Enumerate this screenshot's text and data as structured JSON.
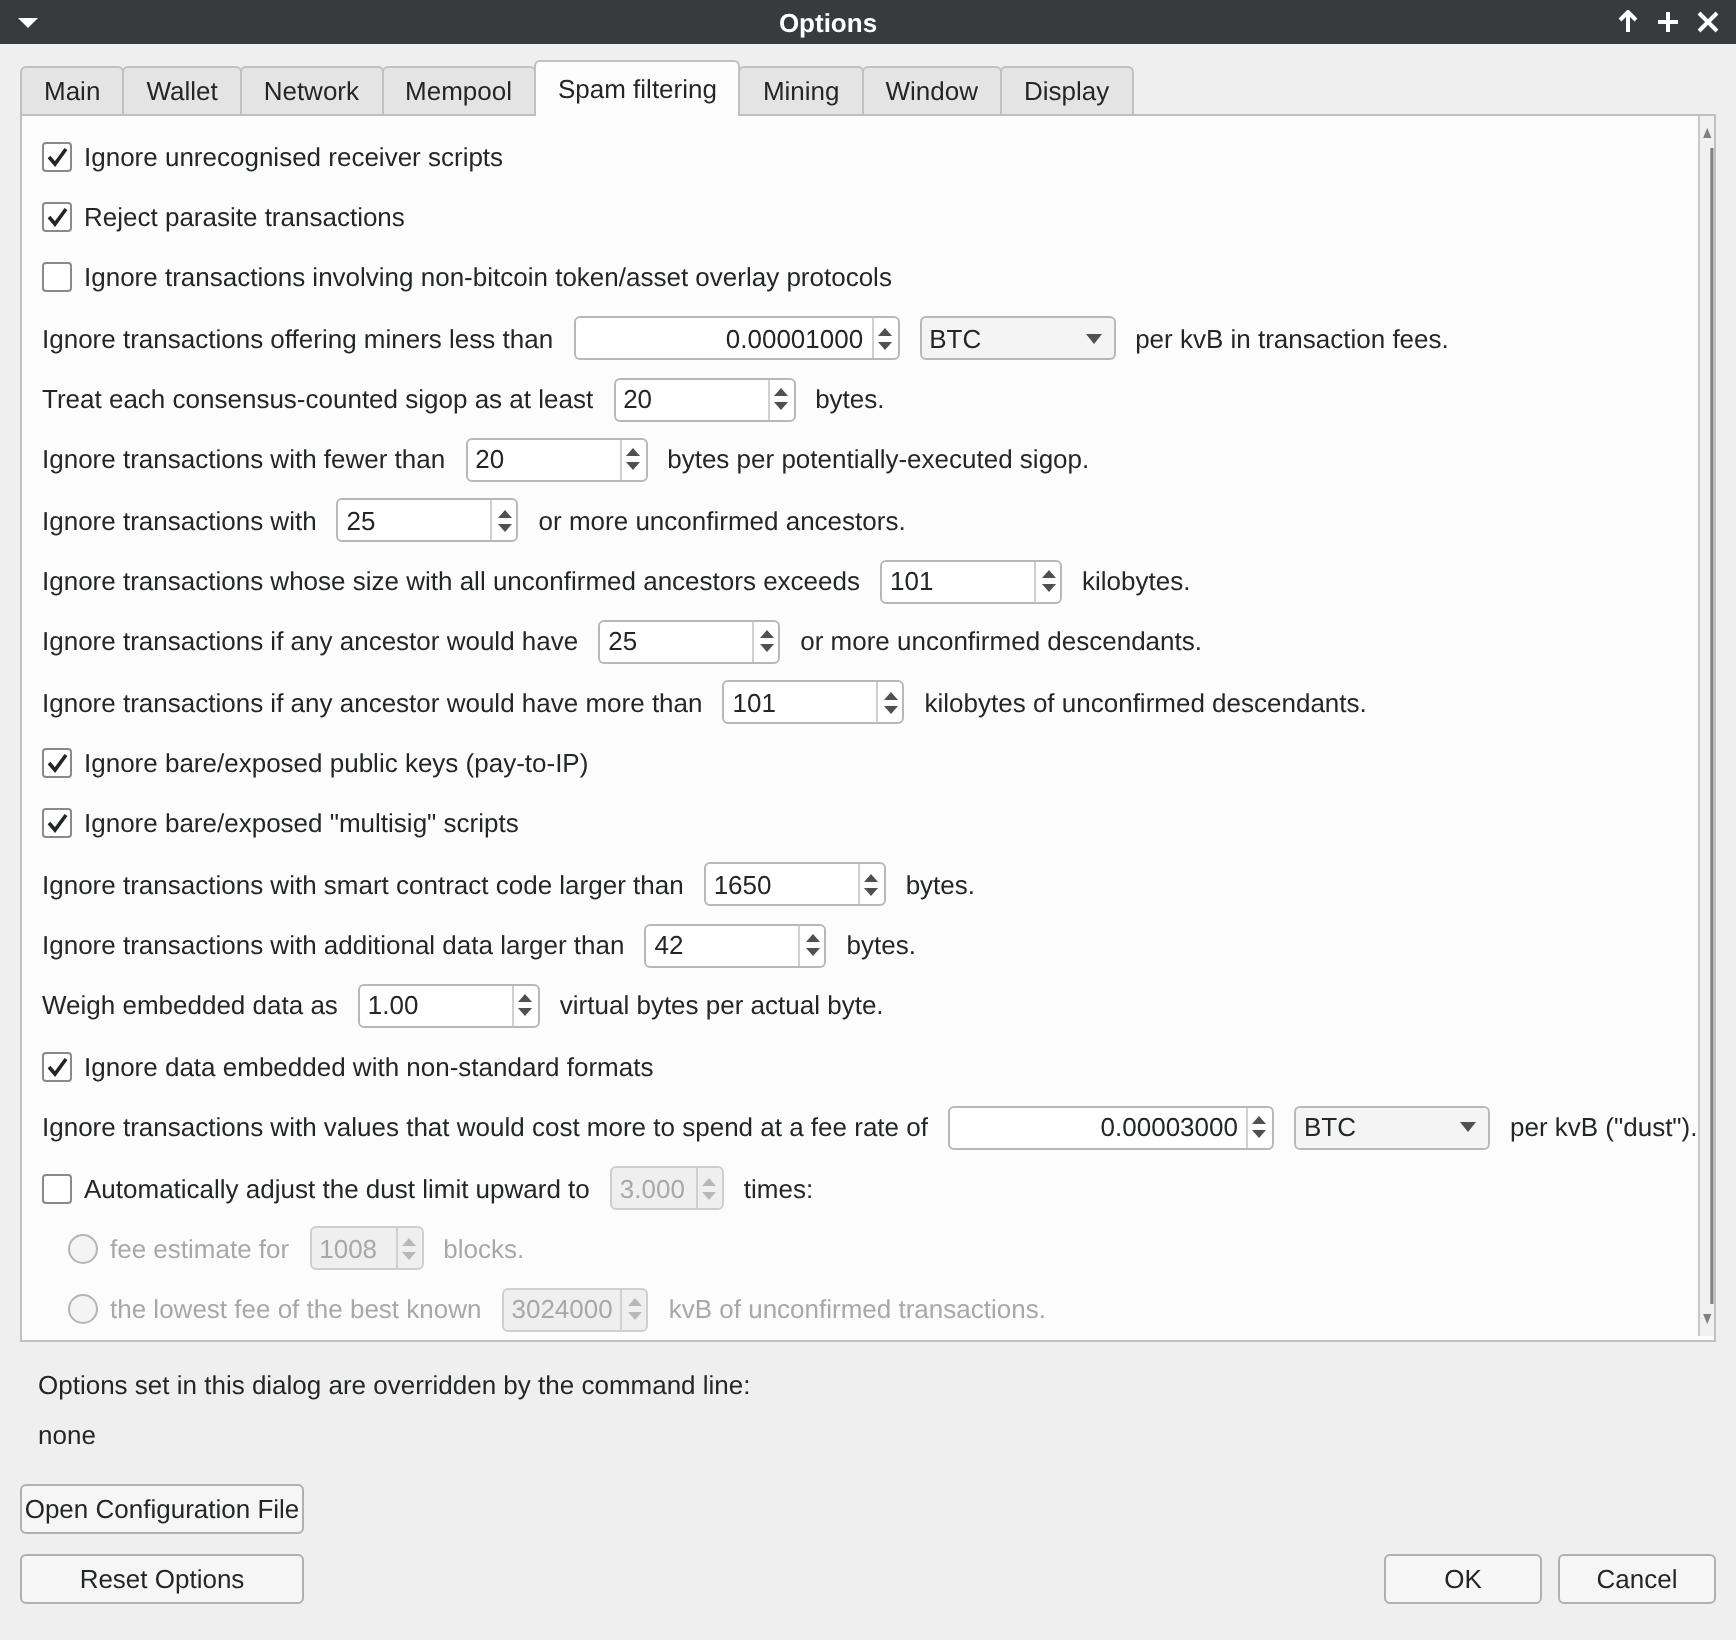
{
  "window": {
    "title": "Options"
  },
  "tabs": [
    {
      "label": "Main",
      "selected": false
    },
    {
      "label": "Wallet",
      "selected": false
    },
    {
      "label": "Network",
      "selected": false
    },
    {
      "label": "Mempool",
      "selected": false
    },
    {
      "label": "Spam filtering",
      "selected": true
    },
    {
      "label": "Mining",
      "selected": false
    },
    {
      "label": "Window",
      "selected": false
    },
    {
      "label": "Display",
      "selected": false
    }
  ],
  "rows": [
    {
      "kind": "checkbox",
      "checked": true,
      "parts": [
        {
          "kind": "text",
          "text": "Ignore unrecognised receiver scripts"
        }
      ]
    },
    {
      "kind": "checkbox",
      "checked": true,
      "parts": [
        {
          "kind": "text",
          "text": "Reject parasite transactions"
        }
      ]
    },
    {
      "kind": "checkbox",
      "checked": false,
      "parts": [
        {
          "kind": "text",
          "text": "Ignore transactions involving non-bitcoin token/asset overlay protocols"
        }
      ]
    },
    {
      "kind": "plain",
      "parts": [
        {
          "kind": "text",
          "text": "Ignore transactions offering miners less than"
        },
        {
          "kind": "amount",
          "value": "0.00001000"
        },
        {
          "kind": "combo",
          "value": "BTC"
        },
        {
          "kind": "text",
          "text": "per kvB in transaction fees."
        }
      ]
    },
    {
      "kind": "plain",
      "parts": [
        {
          "kind": "text",
          "text": "Treat each consensus-counted sigop as at least"
        },
        {
          "kind": "spin",
          "value": "20"
        },
        {
          "kind": "text",
          "text": "bytes."
        }
      ]
    },
    {
      "kind": "plain",
      "parts": [
        {
          "kind": "text",
          "text": "Ignore transactions with fewer than"
        },
        {
          "kind": "spin",
          "value": "20"
        },
        {
          "kind": "text",
          "text": "bytes per potentially-executed sigop."
        }
      ]
    },
    {
      "kind": "plain",
      "parts": [
        {
          "kind": "text",
          "text": "Ignore transactions with"
        },
        {
          "kind": "spin",
          "value": "25"
        },
        {
          "kind": "text",
          "text": "or more unconfirmed ancestors."
        }
      ]
    },
    {
      "kind": "plain",
      "parts": [
        {
          "kind": "text",
          "text": "Ignore transactions whose size with all unconfirmed ancestors exceeds"
        },
        {
          "kind": "spin",
          "value": "101"
        },
        {
          "kind": "text",
          "text": "kilobytes."
        }
      ]
    },
    {
      "kind": "plain",
      "parts": [
        {
          "kind": "text",
          "text": "Ignore transactions if any ancestor would have"
        },
        {
          "kind": "spin",
          "value": "25"
        },
        {
          "kind": "text",
          "text": "or more unconfirmed descendants."
        }
      ]
    },
    {
      "kind": "plain",
      "parts": [
        {
          "kind": "text",
          "text": "Ignore transactions if any ancestor would have more than"
        },
        {
          "kind": "spin",
          "value": "101"
        },
        {
          "kind": "text",
          "text": "kilobytes of unconfirmed descendants."
        }
      ]
    },
    {
      "kind": "checkbox",
      "checked": true,
      "parts": [
        {
          "kind": "text",
          "text": "Ignore bare/exposed public keys (pay-to-IP)"
        }
      ]
    },
    {
      "kind": "checkbox",
      "checked": true,
      "parts": [
        {
          "kind": "text",
          "text": "Ignore bare/exposed \"multisig\" scripts"
        }
      ]
    },
    {
      "kind": "plain",
      "parts": [
        {
          "kind": "text",
          "text": "Ignore transactions with smart contract code larger than"
        },
        {
          "kind": "spin",
          "value": "1650"
        },
        {
          "kind": "text",
          "text": "bytes."
        }
      ]
    },
    {
      "kind": "plain",
      "parts": [
        {
          "kind": "text",
          "text": "Ignore transactions with additional data larger than"
        },
        {
          "kind": "spin",
          "value": "42"
        },
        {
          "kind": "text",
          "text": "bytes."
        }
      ]
    },
    {
      "kind": "plain",
      "parts": [
        {
          "kind": "text",
          "text": "Weigh embedded data as"
        },
        {
          "kind": "spin",
          "value": "1.00"
        },
        {
          "kind": "text",
          "text": "virtual bytes per actual byte."
        }
      ]
    },
    {
      "kind": "checkbox",
      "checked": true,
      "parts": [
        {
          "kind": "text",
          "text": "Ignore data embedded with non-standard formats"
        }
      ]
    },
    {
      "kind": "plain",
      "parts": [
        {
          "kind": "text",
          "text": "Ignore transactions with values that would cost more to spend at a fee rate of"
        },
        {
          "kind": "amount",
          "value": "0.00003000"
        },
        {
          "kind": "combo",
          "value": "BTC"
        },
        {
          "kind": "text",
          "text": "per kvB (\"dust\")."
        }
      ]
    },
    {
      "kind": "checkbox",
      "checked": false,
      "parts": [
        {
          "kind": "text",
          "text": "Automatically adjust the dust limit upward to"
        },
        {
          "kind": "spin",
          "value": "3.000",
          "disabled": true
        },
        {
          "kind": "text",
          "text": "times:"
        }
      ]
    },
    {
      "kind": "radio",
      "selected": false,
      "disabled": true,
      "parts": [
        {
          "kind": "text",
          "text": "fee estimate for"
        },
        {
          "kind": "spin",
          "value": "1008"
        },
        {
          "kind": "text",
          "text": "blocks."
        }
      ]
    },
    {
      "kind": "radio",
      "selected": false,
      "disabled": true,
      "parts": [
        {
          "kind": "text",
          "text": "the lowest fee of the best known"
        },
        {
          "kind": "spin",
          "value": "3024000"
        },
        {
          "kind": "text",
          "text": "kvB of unconfirmed transactions."
        }
      ]
    }
  ],
  "overrides": {
    "label": "Options set in this dialog are overridden by the command line:",
    "value": "none"
  },
  "left_buttons": [
    "Open Configuration File",
    "Reset Options"
  ],
  "right_buttons": [
    "OK",
    "Cancel"
  ]
}
